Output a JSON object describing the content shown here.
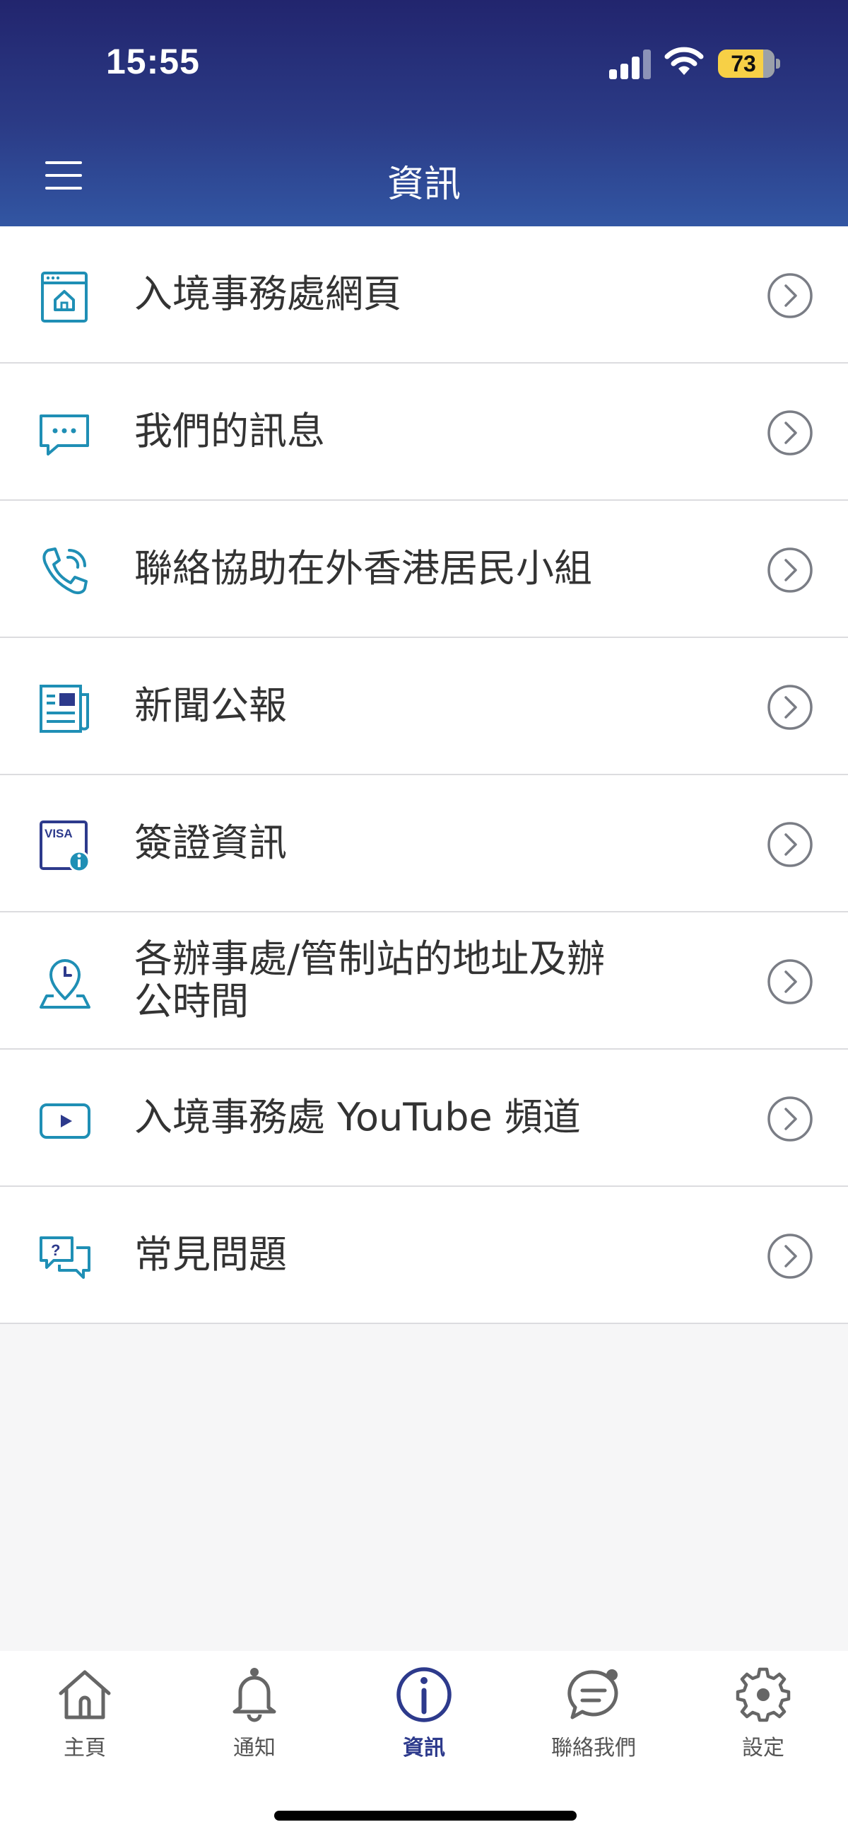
{
  "status_bar": {
    "time": "15:55",
    "battery": "73"
  },
  "header": {
    "title": "資訊"
  },
  "menu_items": [
    {
      "label": "入境事務處網頁",
      "icon": "webpage-icon"
    },
    {
      "label": "我們的訊息",
      "icon": "message-bubble-icon"
    },
    {
      "label": "聯絡協助在外香港居民小組",
      "icon": "phone-call-icon"
    },
    {
      "label": "新聞公報",
      "icon": "newspaper-icon"
    },
    {
      "label": "簽證資訊",
      "icon": "visa-info-icon",
      "badge": "VISA"
    },
    {
      "label": "各辦事處/管制站的地址及辦公時間",
      "icon": "location-clock-icon"
    },
    {
      "label": "入境事務處 YouTube 頻道",
      "icon": "youtube-icon"
    },
    {
      "label": "常見問題",
      "icon": "faq-icon"
    }
  ],
  "tabs": [
    {
      "label": "主頁",
      "icon": "home-icon"
    },
    {
      "label": "通知",
      "icon": "bell-icon"
    },
    {
      "label": "資訊",
      "icon": "info-icon"
    },
    {
      "label": "聯絡我們",
      "icon": "chat-icon"
    },
    {
      "label": "設定",
      "icon": "gear-icon"
    }
  ],
  "active_tab": "資訊",
  "colors": {
    "header_top": "#22256e",
    "header_bottom": "#3256a3",
    "icon_teal": "#1f8fb5",
    "active_tab": "#2d3a8c",
    "battery": "#f7d046"
  }
}
